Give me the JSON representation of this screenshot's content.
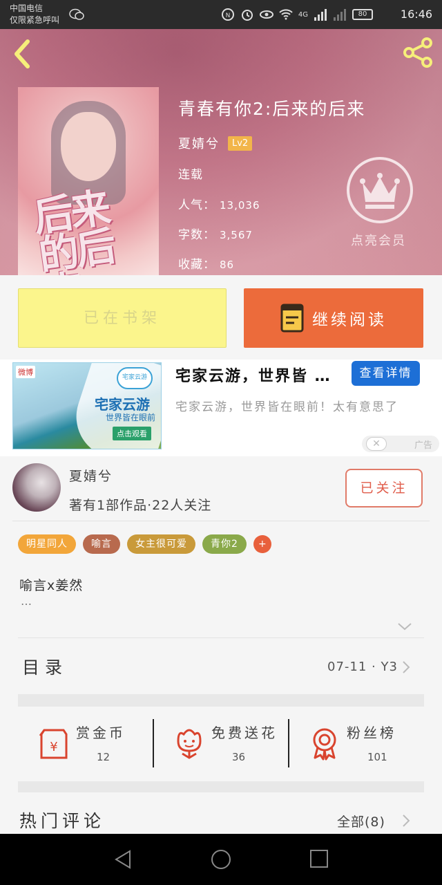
{
  "status_bar": {
    "carrier_line1": "中国电信",
    "carrier_line2": "仅限紧急呼叫",
    "network": "4G",
    "battery": "80",
    "time": "16:46"
  },
  "book": {
    "title": "青春有你2:后来的后来",
    "author": "夏婧兮",
    "level": "Lv2",
    "status": "连载",
    "popularity_label": "人气：",
    "popularity": "13,036",
    "words_label": "字数：",
    "words": "3,567",
    "favorites_label": "收藏：",
    "favorites": "86",
    "cover_text": "后来的后来"
  },
  "vip": {
    "label": "点亮会员"
  },
  "actions": {
    "shelf_label": "已在书架",
    "read_label": "继续阅读"
  },
  "ad": {
    "brand": "微博",
    "image_title": "宅家云游",
    "image_subtitle": "世界皆在眼前",
    "image_cta": "点击观看",
    "cloud_text": "宅家云游",
    "title": "宅家云游，世界皆 …",
    "detail_button": "查看详情",
    "description": "宅家云游，世界皆在眼前！太有意思了",
    "close": "✕",
    "ad_label": "广告"
  },
  "author_card": {
    "name": "夏婧兮",
    "meta": "著有1部作品·22人关注",
    "follow_button": "已关注"
  },
  "tags": [
    {
      "label": "明星同人",
      "color": "#f2a63a"
    },
    {
      "label": "喻言",
      "color": "#b86a4e"
    },
    {
      "label": "女主很可爱",
      "color": "#c99a3a"
    },
    {
      "label": "青你2",
      "color": "#8aa94a"
    }
  ],
  "tag_more": "+",
  "description": {
    "text": "喻言x姜然",
    "more": "…"
  },
  "toc": {
    "title": "目录",
    "latest": "07-11 · Y3"
  },
  "stats": [
    {
      "label": "赏金币",
      "value": "12",
      "icon": "red-envelope-icon"
    },
    {
      "label": "免费送花",
      "value": "36",
      "icon": "flower-icon"
    },
    {
      "label": "粉丝榜",
      "value": "101",
      "icon": "medal-icon"
    }
  ],
  "comments": {
    "title": "热门评论",
    "all_label": "全部(8)"
  },
  "colors": {
    "accent_orange": "#ec6b3b",
    "shelf_yellow": "#fbf58c",
    "ad_blue": "#1d6fd6"
  }
}
